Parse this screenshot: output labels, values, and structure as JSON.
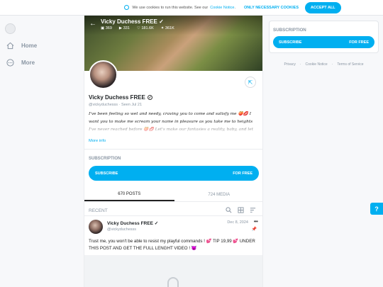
{
  "cookie_bar": {
    "text": "We use cookies to run this website. See our",
    "link": "Cookie Notice",
    "dot": ".",
    "necessary_label": "ONLY NECESSARY COOKIES",
    "accept_label": "ACCEPT ALL"
  },
  "nav": {
    "items": [
      {
        "label": "Home",
        "icon": "home-icon"
      },
      {
        "label": "More",
        "icon": "more-icon"
      }
    ]
  },
  "profile": {
    "cover_title": "Vicky Duchess FREE",
    "stats": {
      "photos": "369",
      "videos": "331",
      "likes": "181.6K",
      "fans": "361K"
    },
    "name": "Vicky Duchess FREE",
    "handle": "@vickyduchesss",
    "seen_sep": "·",
    "seen": "Seen Jul 21",
    "bio": "I've been feeling so wet and needy, craving you to come and satisfy me 🍑💋 I want you to make me scream your name in pleasure as you take me to heights I've never reached before 🍑💋 Let's make our fantasies a reality, baby, and let me show you just",
    "more_info": "More info"
  },
  "subscription": {
    "label": "SUBSCRIPTION",
    "button_left": "SUBSCRIBE",
    "button_right": "FOR FREE"
  },
  "tabs": [
    {
      "label": "670 POSTS",
      "active": true
    },
    {
      "label": "724 MEDIA",
      "active": false
    }
  ],
  "feed": {
    "section_label": "RECENT",
    "post": {
      "author": "Vicky Duchess FREE",
      "handle": "@vickyduchesss",
      "date": "Dec 8, 2024",
      "text": "Trust me, you won't be able to resist my playful commands ! 💕 TIP 19,99 💕 UNDER THIS POST AND GET THE FULL LENGHT VIDEO ! 😈"
    }
  },
  "sidebar_right": {
    "label": "SUBSCRIPTION",
    "button_left": "SUBSCRIBE",
    "button_right": "FOR FREE",
    "links": [
      "Privacy",
      "·",
      "Cookie Notice",
      "·",
      "Terms of Service"
    ]
  },
  "colors": {
    "accent": "#00aff0",
    "muted": "#8a96a3"
  }
}
